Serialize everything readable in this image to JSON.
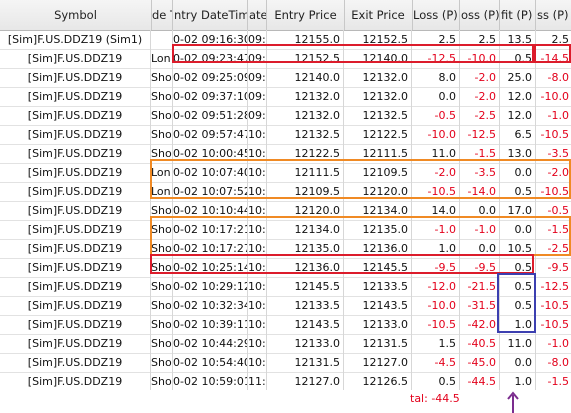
{
  "headers": {
    "symbol": "Symbol",
    "side": "de T",
    "entry_time": "ntry DateTime",
    "exit_time": "ate",
    "entry_price": "Entry Price",
    "exit_price": "Exit Price",
    "mae": "Loss (P)",
    "cum_loss": "oss (P)",
    "profit": "fit (P)",
    "last": "ss (P)"
  },
  "rows": [
    {
      "symbol": "[Sim]F.US.DDZ19 (Sim1)",
      "side": "",
      "time": "0-02  09:16:30",
      "exit": "09:",
      "entry": "12155.0",
      "exitp": "12152.5",
      "mae": "2.5",
      "loss": "2.5",
      "prof": "13.5",
      "last": "2.5"
    },
    {
      "symbol": "[Sim]F.US.DDZ19",
      "side": "Lon",
      "time": "0-02  09:23:47",
      "exit": "09:",
      "entry": "12152.5",
      "exitp": "12140.0",
      "mae": "-12.5",
      "loss": "-10.0",
      "prof": "0.5",
      "last": "-14.5"
    },
    {
      "symbol": "[Sim]F.US.DDZ19",
      "side": "Shor",
      "time": "0-02  09:25:09",
      "exit": "09:",
      "entry": "12140.0",
      "exitp": "12132.0",
      "mae": "8.0",
      "loss": "-2.0",
      "prof": "25.0",
      "last": "-8.0"
    },
    {
      "symbol": "[Sim]F.US.DDZ19",
      "side": "Shor",
      "time": "0-02  09:37:10",
      "exit": "09:",
      "entry": "12132.0",
      "exitp": "12132.0",
      "mae": "0.0",
      "loss": "-2.0",
      "prof": "12.0",
      "last": "-10.0"
    },
    {
      "symbol": "[Sim]F.US.DDZ19",
      "side": "Shor",
      "time": "0-02  09:51:28",
      "exit": "09:",
      "entry": "12132.0",
      "exitp": "12132.5",
      "mae": "-0.5",
      "loss": "-2.5",
      "prof": "12.0",
      "last": "-1.0"
    },
    {
      "symbol": "[Sim]F.US.DDZ19",
      "side": "Shor",
      "time": "0-02  09:57:47",
      "exit": "10:",
      "entry": "12132.5",
      "exitp": "12122.5",
      "mae": "-10.0",
      "loss": "-12.5",
      "prof": "6.5",
      "last": "-10.5"
    },
    {
      "symbol": "[Sim]F.US.DDZ19",
      "side": "Shor",
      "time": "0-02  10:00:45",
      "exit": "10:",
      "entry": "12122.5",
      "exitp": "12111.5",
      "mae": "11.0",
      "loss": "-1.5",
      "prof": "13.0",
      "last": "-3.5"
    },
    {
      "symbol": "[Sim]F.US.DDZ19",
      "side": "Lon",
      "time": "0-02  10:07:40",
      "exit": "10:",
      "entry": "12111.5",
      "exitp": "12109.5",
      "mae": "-2.0",
      "loss": "-3.5",
      "prof": "0.0",
      "last": "-2.0"
    },
    {
      "symbol": "[Sim]F.US.DDZ19",
      "side": "Lon",
      "time": "0-02  10:07:52",
      "exit": "10:",
      "entry": "12109.5",
      "exitp": "12120.0",
      "mae": "-10.5",
      "loss": "-14.0",
      "prof": "0.5",
      "last": "-10.5"
    },
    {
      "symbol": "[Sim]F.US.DDZ19",
      "side": "Shor",
      "time": "0-02  10:10:44",
      "exit": "10:",
      "entry": "12120.0",
      "exitp": "12134.0",
      "mae": "14.0",
      "loss": "0.0",
      "prof": "17.0",
      "last": "-0.5"
    },
    {
      "symbol": "[Sim]F.US.DDZ19",
      "side": "Shor",
      "time": "0-02  10:17:21",
      "exit": "10:",
      "entry": "12134.0",
      "exitp": "12135.0",
      "mae": "-1.0",
      "loss": "-1.0",
      "prof": "0.0",
      "last": "-1.5"
    },
    {
      "symbol": "[Sim]F.US.DDZ19",
      "side": "Shor",
      "time": "0-02  10:17:27",
      "exit": "10:",
      "entry": "12135.0",
      "exitp": "12136.0",
      "mae": "1.0",
      "loss": "0.0",
      "prof": "10.5",
      "last": "-2.5"
    },
    {
      "symbol": "[Sim]F.US.DDZ19",
      "side": "Shor",
      "time": "0-02  10:25:14",
      "exit": "10:",
      "entry": "12136.0",
      "exitp": "12145.5",
      "mae": "-9.5",
      "loss": "-9.5",
      "prof": "0.5",
      "last": "-9.5"
    },
    {
      "symbol": "[Sim]F.US.DDZ19",
      "side": "Shor",
      "time": "0-02  10:29:12",
      "exit": "10:",
      "entry": "12145.5",
      "exitp": "12133.5",
      "mae": "-12.0",
      "loss": "-21.5",
      "prof": "0.5",
      "last": "-12.5"
    },
    {
      "symbol": "[Sim]F.US.DDZ19",
      "side": "Shor",
      "time": "0-02  10:32:34",
      "exit": "10:",
      "entry": "12133.5",
      "exitp": "12143.5",
      "mae": "-10.0",
      "loss": "-31.5",
      "prof": "0.5",
      "last": "-10.5"
    },
    {
      "symbol": "[Sim]F.US.DDZ19",
      "side": "Shor",
      "time": "0-02  10:39:11",
      "exit": "10:",
      "entry": "12143.5",
      "exitp": "12133.0",
      "mae": "-10.5",
      "loss": "-42.0",
      "prof": "1.0",
      "last": "-10.5"
    },
    {
      "symbol": "[Sim]F.US.DDZ19",
      "side": "Shor",
      "time": "0-02  10:44:29",
      "exit": "10:",
      "entry": "12133.0",
      "exitp": "12131.5",
      "mae": "1.5",
      "loss": "-40.5",
      "prof": "11.0",
      "last": "-1.0"
    },
    {
      "symbol": "[Sim]F.US.DDZ19",
      "side": "Shor",
      "time": "0-02  10:54:40",
      "exit": "10:",
      "entry": "12131.5",
      "exitp": "12127.0",
      "mae": "-4.5",
      "loss": "-45.0",
      "prof": "0.0",
      "last": "-8.0"
    },
    {
      "symbol": "[Sim]F.US.DDZ19",
      "side": "Shor",
      "time": "0-02  10:59:01",
      "exit": "11:",
      "entry": "12127.0",
      "exitp": "12126.5",
      "mae": "0.5",
      "loss": "-44.5",
      "prof": "1.0",
      "last": "-1.5"
    }
  ],
  "total": {
    "label": "tal: -44.5"
  },
  "colors": {
    "negative": "#e3001b",
    "box_red": "#dc1c2b",
    "box_orange": "#f08a24",
    "box_blue": "#3c3fb0",
    "arrow": "#7b2d8e"
  },
  "icons": {
    "annotation_arrow": "up-arrow-icon"
  }
}
